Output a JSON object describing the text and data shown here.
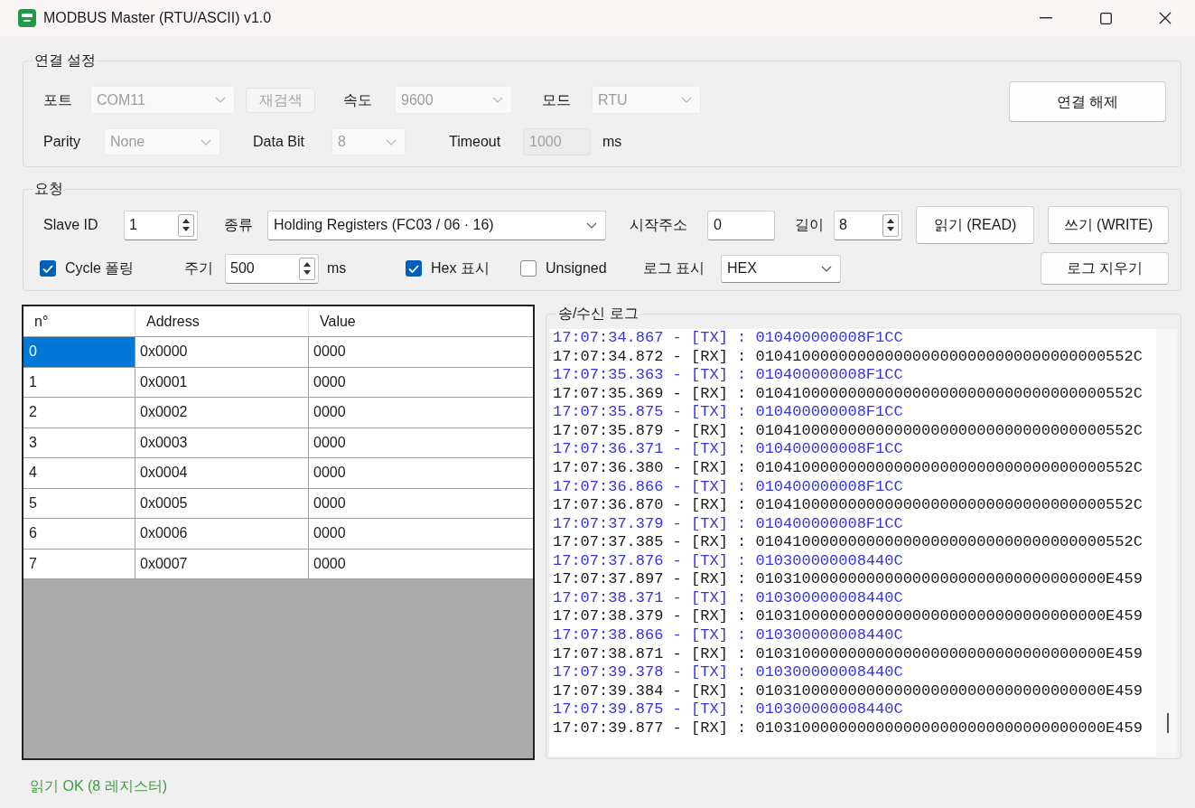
{
  "window": {
    "title": "MODBUS Master (RTU/ASCII) v1.0"
  },
  "connection": {
    "title": "연결 설정",
    "port": {
      "label": "포트",
      "value": "COM11",
      "disabled": true
    },
    "rescan_button": {
      "label": "재검색",
      "disabled": true
    },
    "baud": {
      "label": "속도",
      "value": "9600",
      "disabled": true
    },
    "mode": {
      "label": "모드",
      "value": "RTU",
      "disabled": true
    },
    "parity": {
      "label": "Parity",
      "value": "None",
      "disabled": true
    },
    "data_bit": {
      "label": "Data Bit",
      "value": "8",
      "disabled": true
    },
    "timeout": {
      "label": "Timeout",
      "value": "1000",
      "unit": "ms",
      "disabled": true
    },
    "disconnect_button": {
      "label": "연결 해제"
    }
  },
  "request": {
    "title": "요청",
    "slave_id": {
      "label": "Slave ID",
      "value": "1"
    },
    "function": {
      "label": "종류",
      "value": "Holding Registers (FC03 / 06 · 16)"
    },
    "start_address": {
      "label": "시작주소",
      "value": "0"
    },
    "length": {
      "label": "길이",
      "value": "8"
    },
    "read_button": {
      "label": "읽기 (READ)"
    },
    "write_button": {
      "label": "쓰기 (WRITE)"
    },
    "cycle_polling": {
      "label": "Cycle 폴링",
      "checked": true
    },
    "period": {
      "label": "주기",
      "value": "500",
      "unit": "ms"
    },
    "hex_display": {
      "label": "Hex 표시",
      "checked": true
    },
    "unsigned": {
      "label": "Unsigned",
      "checked": false
    },
    "log_display": {
      "label": "로그 표시",
      "value": "HEX"
    },
    "clear_log_button": {
      "label": "로그 지우기"
    }
  },
  "table": {
    "columns": [
      "n°",
      "Address",
      "Value"
    ],
    "rows": [
      {
        "n": "0",
        "address": "0x0000",
        "value": "0000",
        "selected": true
      },
      {
        "n": "1",
        "address": "0x0001",
        "value": "0000",
        "selected": false
      },
      {
        "n": "2",
        "address": "0x0002",
        "value": "0000",
        "selected": false
      },
      {
        "n": "3",
        "address": "0x0003",
        "value": "0000",
        "selected": false
      },
      {
        "n": "4",
        "address": "0x0004",
        "value": "0000",
        "selected": false
      },
      {
        "n": "5",
        "address": "0x0005",
        "value": "0000",
        "selected": false
      },
      {
        "n": "6",
        "address": "0x0006",
        "value": "0000",
        "selected": false
      },
      {
        "n": "7",
        "address": "0x0007",
        "value": "0000",
        "selected": false
      }
    ]
  },
  "log": {
    "title": "송/수신 로그",
    "lines": [
      {
        "kind": "tx",
        "text": "17:07:34.867 - [TX] : 010400000008F1CC"
      },
      {
        "kind": "rx",
        "text": "17:07:34.872 - [RX] : 01041000000000000000000000000000000000552C"
      },
      {
        "kind": "tx",
        "text": "17:07:35.363 - [TX] : 010400000008F1CC"
      },
      {
        "kind": "rx",
        "text": "17:07:35.369 - [RX] : 01041000000000000000000000000000000000552C"
      },
      {
        "kind": "tx",
        "text": "17:07:35.875 - [TX] : 010400000008F1CC"
      },
      {
        "kind": "rx",
        "text": "17:07:35.879 - [RX] : 01041000000000000000000000000000000000552C"
      },
      {
        "kind": "tx",
        "text": "17:07:36.371 - [TX] : 010400000008F1CC"
      },
      {
        "kind": "rx",
        "text": "17:07:36.380 - [RX] : 01041000000000000000000000000000000000552C"
      },
      {
        "kind": "tx",
        "text": "17:07:36.866 - [TX] : 010400000008F1CC"
      },
      {
        "kind": "rx",
        "text": "17:07:36.870 - [RX] : 01041000000000000000000000000000000000552C"
      },
      {
        "kind": "tx",
        "text": "17:07:37.379 - [TX] : 010400000008F1CC"
      },
      {
        "kind": "rx",
        "text": "17:07:37.385 - [RX] : 01041000000000000000000000000000000000552C"
      },
      {
        "kind": "tx",
        "text": "17:07:37.876 - [TX] : 010300000008440C"
      },
      {
        "kind": "rx",
        "text": "17:07:37.897 - [RX] : 01031000000000000000000000000000000000E459"
      },
      {
        "kind": "tx",
        "text": "17:07:38.371 - [TX] : 010300000008440C"
      },
      {
        "kind": "rx",
        "text": "17:07:38.379 - [RX] : 01031000000000000000000000000000000000E459"
      },
      {
        "kind": "tx",
        "text": "17:07:38.866 - [TX] : 010300000008440C"
      },
      {
        "kind": "rx",
        "text": "17:07:38.871 - [RX] : 01031000000000000000000000000000000000E459"
      },
      {
        "kind": "tx",
        "text": "17:07:39.378 - [TX] : 010300000008440C"
      },
      {
        "kind": "rx",
        "text": "17:07:39.384 - [RX] : 01031000000000000000000000000000000000E459"
      },
      {
        "kind": "tx",
        "text": "17:07:39.875 - [TX] : 010300000008440C"
      },
      {
        "kind": "rx",
        "text": "17:07:39.877 - [RX] : 01031000000000000000000000000000000000E459"
      }
    ]
  },
  "status_bar": {
    "text": "읽기 OK (8 레지스터)"
  }
}
